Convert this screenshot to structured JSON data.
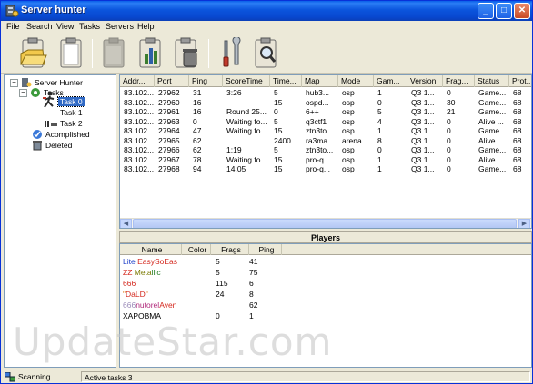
{
  "window": {
    "title": "Server hunter"
  },
  "menu": [
    "File",
    "Search",
    "View",
    "Tasks",
    "Servers",
    "Help"
  ],
  "toolbar": {
    "buttons": [
      "open-folder-icon",
      "new-task-icon",
      "paste-task-icon",
      "statistics-icon",
      "delete-icon",
      "settings-icon",
      "find-icon"
    ]
  },
  "tree": {
    "root": "Server Hunter",
    "tasks": "Tasks",
    "task0": "Task 0",
    "task1": "Task 1",
    "task2": "Task 2",
    "accomplished": "Acomplished",
    "deleted": "Deleted"
  },
  "servers": {
    "columns": [
      "Addr...",
      "Port",
      "Ping",
      "ScoreTime",
      "Time...",
      "Map",
      "Mode",
      "Gam...",
      "Version",
      "Frag...",
      "Status",
      "Prot..."
    ],
    "rows": [
      [
        "83.102...",
        "27962",
        "31",
        "3:26",
        "5",
        "hub3...",
        "osp",
        "1",
        "Q3 1...",
        "0",
        "Game...",
        "68"
      ],
      [
        "83.102...",
        "27960",
        "16",
        "",
        "15",
        "ospd...",
        "osp",
        "0",
        "Q3 1...",
        "30",
        "Game...",
        "68"
      ],
      [
        "83.102...",
        "27961",
        "16",
        "Round 25...",
        "0",
        "6++",
        "osp",
        "5",
        "Q3 1...",
        "21",
        "Game...",
        "68"
      ],
      [
        "83.102...",
        "27963",
        "0",
        "Waiting fo...",
        "5",
        "q3ctf1",
        "osp",
        "4",
        "Q3 1...",
        "0",
        "Alive ...",
        "68"
      ],
      [
        "83.102...",
        "27964",
        "47",
        "Waiting fo...",
        "15",
        "ztn3to...",
        "osp",
        "1",
        "Q3 1...",
        "0",
        "Game...",
        "68"
      ],
      [
        "83.102...",
        "27965",
        "62",
        "",
        "2400",
        "ra3ma...",
        "arena",
        "8",
        "Q3 1...",
        "0",
        "Alive ...",
        "68"
      ],
      [
        "83.102...",
        "27966",
        "62",
        "1:19",
        "5",
        "ztn3to...",
        "osp",
        "0",
        "Q3 1...",
        "0",
        "Game...",
        "68"
      ],
      [
        "83.102...",
        "27967",
        "78",
        "Waiting fo...",
        "15",
        "pro-q...",
        "osp",
        "1",
        "Q3 1...",
        "0",
        "Alive ...",
        "68"
      ],
      [
        "83.102...",
        "27968",
        "94",
        "14:05",
        "15",
        "pro-q...",
        "osp",
        "1",
        "Q3 1...",
        "0",
        "Game...",
        "68"
      ]
    ]
  },
  "players": {
    "title": "Players",
    "columns": [
      "Name",
      "Color",
      "Frags",
      "Ping"
    ],
    "rows": [
      {
        "segments": [
          {
            "t": "Lite",
            "c": "#1e3fc8"
          },
          {
            "t": " EasySoEas",
            "c": "#d4281e"
          }
        ],
        "color": "",
        "frags": "5",
        "ping": "41"
      },
      {
        "segments": [
          {
            "t": "ZZ",
            "c": "#d4281e"
          },
          {
            "t": " Meta",
            "c": "#7a7a00"
          },
          {
            "t": "llic",
            "c": "#1e7a1e"
          }
        ],
        "color": "",
        "frags": "5",
        "ping": "75"
      },
      {
        "segments": [
          {
            "t": "666",
            "c": "#d4281e"
          }
        ],
        "color": "",
        "frags": "115",
        "ping": "6"
      },
      {
        "segments": [
          {
            "t": "\"",
            "c": "#e07a20"
          },
          {
            "t": "DaLD",
            "c": "#d4281e"
          },
          {
            "t": "\"",
            "c": "#e07a20"
          }
        ],
        "color": "",
        "frags": "24",
        "ping": "8"
      },
      {
        "segments": [
          {
            "t": "666",
            "c": "#9a8ab8"
          },
          {
            "t": "nutorel",
            "c": "#b0287a"
          },
          {
            "t": "Aven",
            "c": "#d4281e"
          }
        ],
        "color": "",
        "frags": "",
        "ping": "62"
      },
      {
        "segments": [
          {
            "t": "XAPOBMA",
            "c": "#000000"
          }
        ],
        "color": "",
        "frags": "0",
        "ping": "1"
      }
    ]
  },
  "statusbar": {
    "left": "Scanning..",
    "right": "Active tasks 3"
  },
  "watermark": "UpdateStar.com"
}
